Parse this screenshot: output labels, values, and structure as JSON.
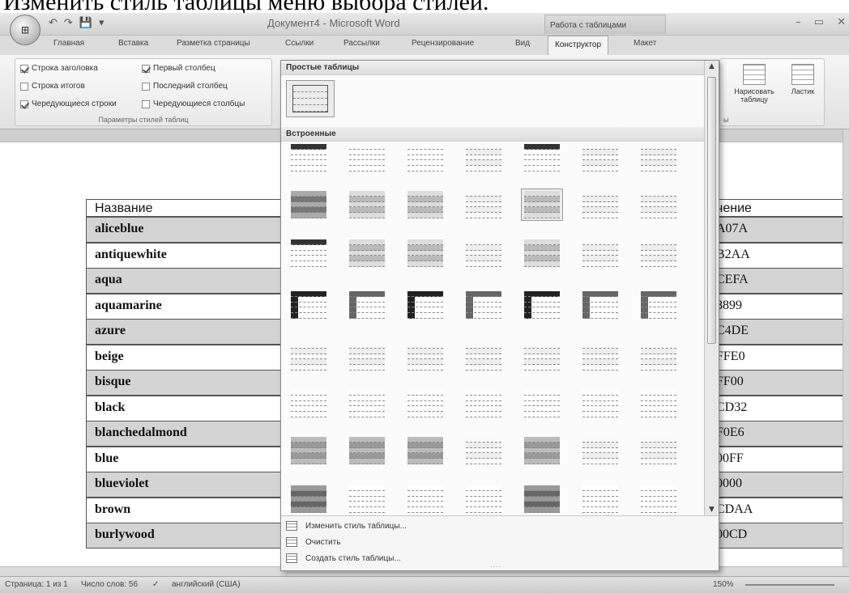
{
  "caption": "Изменить стиль таблицы меню выбора стилей.",
  "titlebar": {
    "qat": [
      "↶",
      "↷",
      "💾",
      "▾"
    ],
    "doc_title": "Документ4 - Microsoft Word",
    "tools_title": "Работа с таблицами",
    "window_controls": [
      "–",
      "▭",
      "✕"
    ]
  },
  "tabs": [
    "Главная",
    "Вставка",
    "Разметка страницы",
    "Ссылки",
    "Рассылки",
    "Рецензирование",
    "Вид",
    "Конструктор",
    "Макет"
  ],
  "active_tab": "Конструктор",
  "ribbon": {
    "style_options": [
      {
        "label": "Строка заголовка",
        "checked": true
      },
      {
        "label": "Первый столбец",
        "checked": true
      },
      {
        "label": "Строка итогов",
        "checked": false
      },
      {
        "label": "Последний столбец",
        "checked": false
      },
      {
        "label": "Чередующиеся строки",
        "checked": true
      },
      {
        "label": "Чередующиеся столбцы",
        "checked": false
      }
    ],
    "style_options_group": "Параметры стилей таблиц",
    "draw_table": "Нарисовать таблицу",
    "eraser": "Ластик",
    "draw_group_suffix": "ы"
  },
  "gallery": {
    "plain_header": "Простые таблицы",
    "builtin_header": "Встроенные",
    "menu": [
      "Изменить стиль таблицы...",
      "Очистить",
      "Создать стиль таблицы..."
    ],
    "grip": "....",
    "styles": [
      [
        "dark-header",
        "plain",
        "plain",
        "light",
        "dark-header",
        "light",
        "light"
      ],
      [
        "dark-grid",
        "grid",
        "grid",
        "light",
        "grid-hover",
        "light",
        "light"
      ],
      [
        "dark-header",
        "grid",
        "grid",
        "light",
        "grid",
        "light",
        "light"
      ],
      [
        "first-col-dark",
        "first-col",
        "first-col-dark",
        "first-col",
        "first-col-dark",
        "first-col",
        "first-col"
      ],
      [
        "light",
        "light",
        "light",
        "light",
        "light",
        "light",
        "light"
      ],
      [
        "lines",
        "lines",
        "lines",
        "lines",
        "lines",
        "lines",
        "lines"
      ],
      [
        "mid",
        "mid",
        "mid",
        "light",
        "mid",
        "light",
        "light"
      ],
      [
        "shaded",
        "lines",
        "lines",
        "lines",
        "shaded",
        "lines",
        "lines"
      ]
    ]
  },
  "colors": {
    "row_shaded": "#d4d4d4",
    "border": "#555555",
    "ribbon_bg": "#e1e1e1"
  },
  "table": {
    "header": {
      "name": "Название",
      "value": "чение"
    },
    "rows": [
      {
        "name": "aliceblue",
        "value": "A07A"
      },
      {
        "name": "antiquewhite",
        "value": "B2AA"
      },
      {
        "name": "aqua",
        "value": "CEFA"
      },
      {
        "name": "aquamarine",
        "value": "8899"
      },
      {
        "name": "azure",
        "value": "C4DE"
      },
      {
        "name": "beige",
        "value": "FFE0"
      },
      {
        "name": "bisque",
        "value": "FF00"
      },
      {
        "name": "black",
        "value": "CD32"
      },
      {
        "name": "blanchedalmond",
        "value": "F0E6"
      },
      {
        "name": "blue",
        "value": "00FF"
      },
      {
        "name": "blueviolet",
        "value": "0000"
      },
      {
        "name": "brown",
        "value": "CDAA"
      },
      {
        "name": "burlywood",
        "value": "00CD"
      }
    ]
  },
  "status": {
    "page": "Страница: 1 из 1",
    "words": "Число слов: 56",
    "language": "английский (США)",
    "zoom": "150%"
  }
}
